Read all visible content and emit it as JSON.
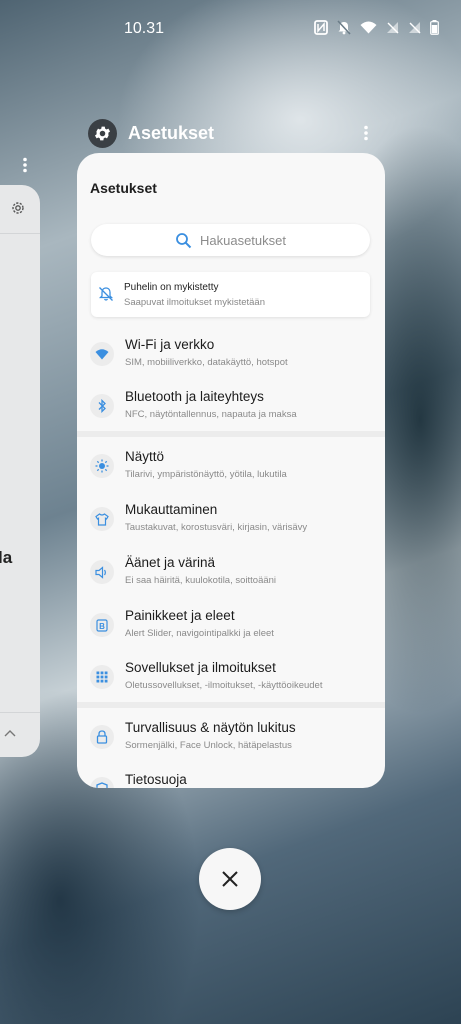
{
  "status_bar": {
    "time": "10.31",
    "icons": [
      "nfc-icon",
      "notifications-muted-icon",
      "wifi-icon",
      "signal-off-icon",
      "signal-off-icon",
      "battery-icon"
    ]
  },
  "background_app": {
    "partial_text": "la",
    "icons": [
      "gear-icon",
      "chevron-up-icon",
      "more-vert-icon"
    ]
  },
  "app_header": {
    "name": "Asetukset",
    "icon": "gear-icon"
  },
  "settings": {
    "title": "Asetukset",
    "search": {
      "placeholder": "Hakuasetukset",
      "icon": "search-icon"
    },
    "notice": {
      "title": "Puhelin on mykistetty",
      "subtitle": "Saapuvat ilmoitukset mykistetään",
      "icon": "notifications-off-icon"
    },
    "items": [
      {
        "title": "Wi-Fi ja verkko",
        "subtitle": "SIM, mobiiliverkko, datakäyttö, hotspot",
        "icon": "wifi-icon"
      },
      {
        "title": "Bluetooth ja laiteyhteys",
        "subtitle": "NFC, näytöntallennus, napauta ja maksa",
        "icon": "bluetooth-icon"
      },
      {
        "title": "Näyttö",
        "subtitle": "Tilarivi, ympäristönäyttö, yötila, lukutila",
        "icon": "brightness-icon"
      },
      {
        "title": "Mukauttaminen",
        "subtitle": "Taustakuvat, korostusväri, kirjasin, värisävy",
        "icon": "tshirt-icon"
      },
      {
        "title": "Äänet ja värinä",
        "subtitle": "Ei saa häiritä, kuulokotila, soittoääni",
        "icon": "volume-icon"
      },
      {
        "title": "Painikkeet ja eleet",
        "subtitle": "Alert Slider, navigointipalkki ja eleet",
        "icon": "buttons-icon"
      },
      {
        "title": "Sovellukset ja ilmoitukset",
        "subtitle": "Oletussovellukset, -ilmoitukset, -käyttöoikeudet",
        "icon": "apps-grid-icon"
      },
      {
        "title": "Turvallisuus & näytön lukitus",
        "subtitle": "Sormenjälki, Face Unlock, hätäpelastus",
        "icon": "lock-icon"
      },
      {
        "title": "Tietosuoja",
        "subtitle": "",
        "icon": "privacy-icon"
      }
    ]
  },
  "colors": {
    "accent": "#3b8fe0",
    "card_bg": "#f8f8f8",
    "icon_bg": "#ececec"
  }
}
